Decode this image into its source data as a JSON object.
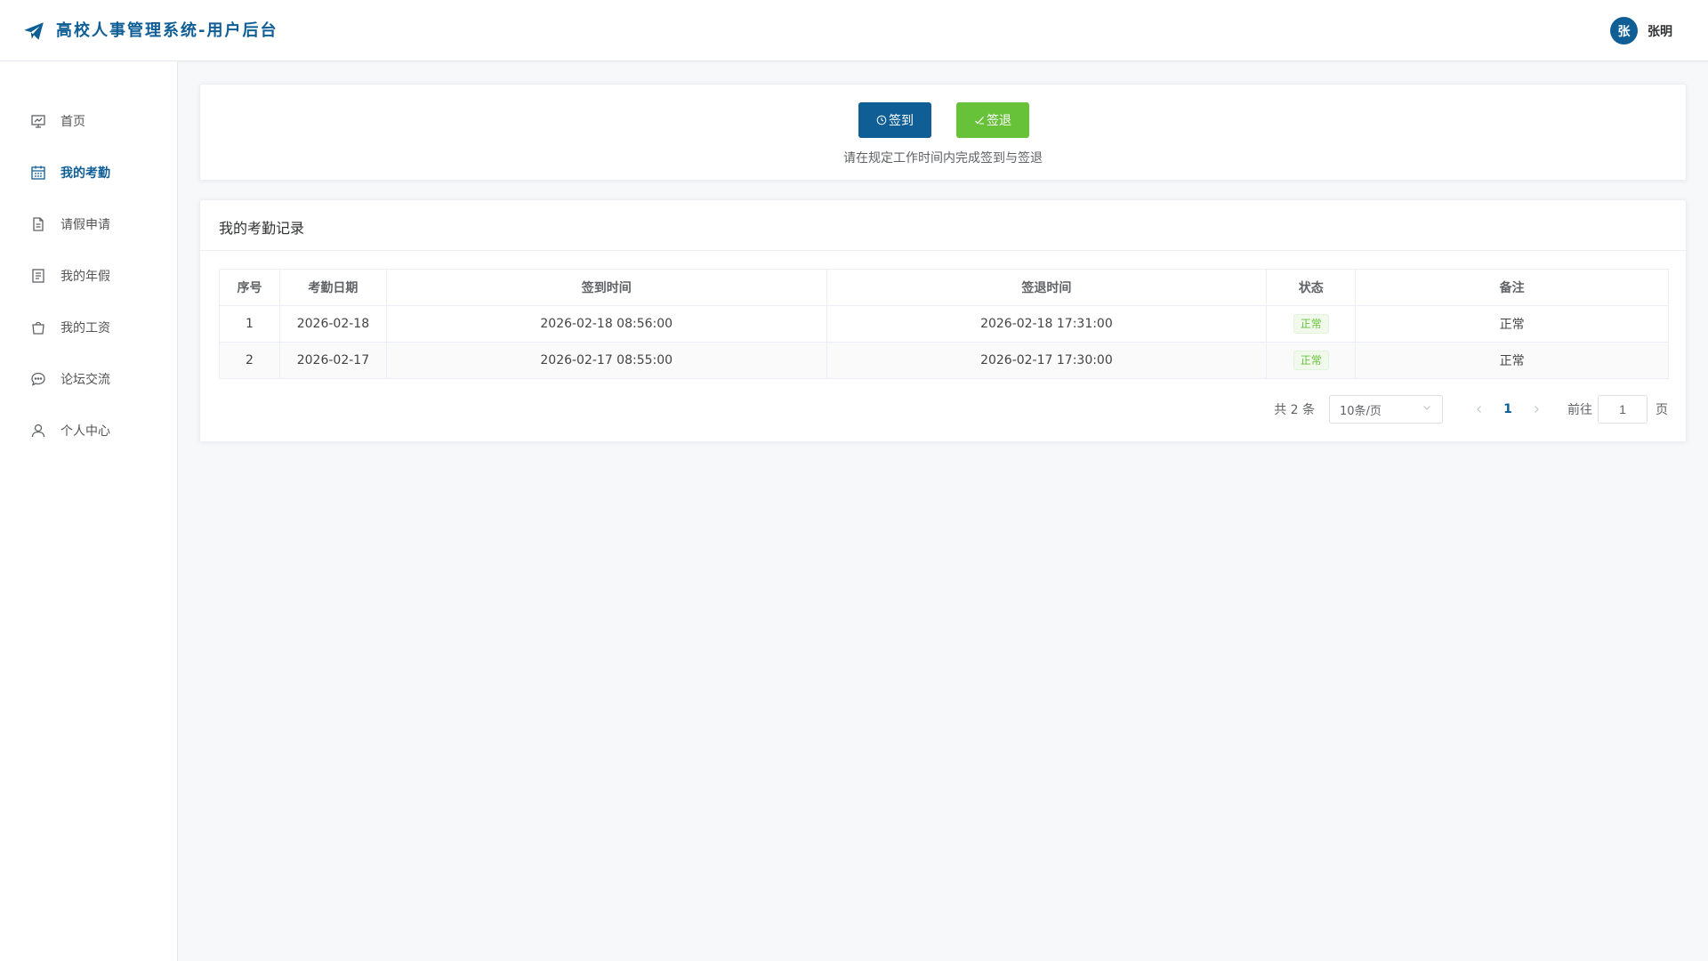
{
  "header": {
    "title": "高校人事管理系统-用户后台",
    "user": {
      "avatar_text": "张",
      "name": "张明"
    },
    "brand_color": "#0f5e96"
  },
  "sidebar": {
    "items": [
      {
        "label": "首页",
        "icon": "chart-board-icon",
        "active": false
      },
      {
        "label": "我的考勤",
        "icon": "calendar-icon",
        "active": true
      },
      {
        "label": "请假申请",
        "icon": "document-icon",
        "active": false
      },
      {
        "label": "我的年假",
        "icon": "notes-icon",
        "active": false
      },
      {
        "label": "我的工资",
        "icon": "shopping-bag-icon",
        "active": false
      },
      {
        "label": "论坛交流",
        "icon": "chat-icon",
        "active": false
      },
      {
        "label": "个人中心",
        "icon": "user-icon",
        "active": false
      }
    ]
  },
  "actions": {
    "signin_label": "签到",
    "signout_label": "签退",
    "hint": "请在规定工作时间内完成签到与签退",
    "signin_color": "#0f5e96",
    "signout_color": "#67c23a"
  },
  "records": {
    "title": "我的考勤记录",
    "columns": [
      "序号",
      "考勤日期",
      "签到时间",
      "签退时间",
      "状态",
      "备注"
    ],
    "rows": [
      {
        "index": "1",
        "date": "2026-02-18",
        "sign_in": "2026-02-18 08:56:00",
        "sign_out": "2026-02-18 17:31:00",
        "status": "正常",
        "remark": "正常"
      },
      {
        "index": "2",
        "date": "2026-02-17",
        "sign_in": "2026-02-17 08:55:00",
        "sign_out": "2026-02-17 17:30:00",
        "status": "正常",
        "remark": "正常"
      }
    ]
  },
  "pagination": {
    "total_text": "共 2 条",
    "page_size": "10条/页",
    "current_page": "1",
    "goto_label": "前往",
    "goto_value": "1",
    "page_unit": "页"
  }
}
